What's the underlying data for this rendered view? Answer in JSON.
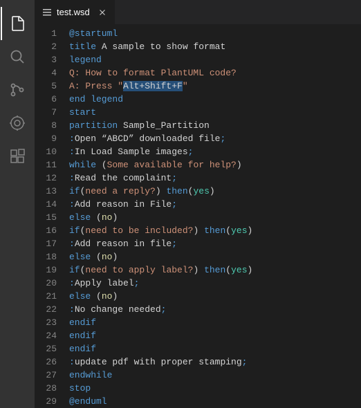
{
  "tab": {
    "filename": "test.wsd"
  },
  "lines": [
    {
      "n": 1,
      "tokens": [
        {
          "t": "@startuml",
          "c": "kw"
        }
      ]
    },
    {
      "n": 2,
      "tokens": [
        {
          "t": "title",
          "c": "kw"
        },
        {
          "t": " A sample to show format",
          "c": "txt"
        }
      ]
    },
    {
      "n": 3,
      "tokens": [
        {
          "t": "legend",
          "c": "kw"
        }
      ]
    },
    {
      "n": 4,
      "tokens": [
        {
          "t": "Q: How to format PlantUML code?",
          "c": "str"
        }
      ]
    },
    {
      "n": 5,
      "tokens": [
        {
          "t": "A: Press \"",
          "c": "str"
        },
        {
          "t": "Alt+Shift+F",
          "c": "sel"
        },
        {
          "t": "\"",
          "c": "str"
        }
      ]
    },
    {
      "n": 6,
      "tokens": [
        {
          "t": "end legend",
          "c": "kw"
        }
      ]
    },
    {
      "n": 7,
      "tokens": [
        {
          "t": "start",
          "c": "kw"
        }
      ]
    },
    {
      "n": 8,
      "tokens": [
        {
          "t": "partition",
          "c": "kw"
        },
        {
          "t": " Sample_Partition",
          "c": "txt"
        }
      ]
    },
    {
      "n": 9,
      "tokens": [
        {
          "t": ":",
          "c": "kw"
        },
        {
          "t": "Open “ABCD” downloaded file",
          "c": "txt"
        },
        {
          "t": ";",
          "c": "kw"
        }
      ]
    },
    {
      "n": 10,
      "tokens": [
        {
          "t": ":",
          "c": "kw"
        },
        {
          "t": "In Load Sample images",
          "c": "txt"
        },
        {
          "t": ";",
          "c": "kw"
        }
      ]
    },
    {
      "n": 11,
      "tokens": [
        {
          "t": "while",
          "c": "kw"
        },
        {
          "t": " (",
          "c": "par"
        },
        {
          "t": "Some available for help?",
          "c": "str"
        },
        {
          "t": ")",
          "c": "par"
        }
      ]
    },
    {
      "n": 12,
      "tokens": [
        {
          "t": ":",
          "c": "kw"
        },
        {
          "t": "Read the complaint",
          "c": "txt"
        },
        {
          "t": ";",
          "c": "kw"
        }
      ]
    },
    {
      "n": 13,
      "tokens": [
        {
          "t": "if",
          "c": "kw"
        },
        {
          "t": "(",
          "c": "par"
        },
        {
          "t": "need a reply?",
          "c": "str"
        },
        {
          "t": ") ",
          "c": "par"
        },
        {
          "t": "then",
          "c": "kw"
        },
        {
          "t": "(",
          "c": "par"
        },
        {
          "t": "yes",
          "c": "yes"
        },
        {
          "t": ")",
          "c": "par"
        }
      ]
    },
    {
      "n": 14,
      "tokens": [
        {
          "t": ":",
          "c": "kw"
        },
        {
          "t": "Add reason in File",
          "c": "txt"
        },
        {
          "t": ";",
          "c": "kw"
        }
      ]
    },
    {
      "n": 15,
      "tokens": [
        {
          "t": "else",
          "c": "kw"
        },
        {
          "t": " (",
          "c": "par"
        },
        {
          "t": "no",
          "c": "func"
        },
        {
          "t": ")",
          "c": "par"
        }
      ]
    },
    {
      "n": 16,
      "tokens": [
        {
          "t": "if",
          "c": "kw"
        },
        {
          "t": "(",
          "c": "par"
        },
        {
          "t": "need to be included?",
          "c": "str"
        },
        {
          "t": ") ",
          "c": "par"
        },
        {
          "t": "then",
          "c": "kw"
        },
        {
          "t": "(",
          "c": "par"
        },
        {
          "t": "yes",
          "c": "yes"
        },
        {
          "t": ")",
          "c": "par"
        }
      ]
    },
    {
      "n": 17,
      "tokens": [
        {
          "t": ":",
          "c": "kw"
        },
        {
          "t": "Add reason in file",
          "c": "txt"
        },
        {
          "t": ";",
          "c": "kw"
        }
      ]
    },
    {
      "n": 18,
      "tokens": [
        {
          "t": "else",
          "c": "kw"
        },
        {
          "t": " (",
          "c": "par"
        },
        {
          "t": "no",
          "c": "func"
        },
        {
          "t": ")",
          "c": "par"
        }
      ]
    },
    {
      "n": 19,
      "tokens": [
        {
          "t": "if",
          "c": "kw"
        },
        {
          "t": "(",
          "c": "par"
        },
        {
          "t": "need to apply label?",
          "c": "str"
        },
        {
          "t": ") ",
          "c": "par"
        },
        {
          "t": "then",
          "c": "kw"
        },
        {
          "t": "(",
          "c": "par"
        },
        {
          "t": "yes",
          "c": "yes"
        },
        {
          "t": ")",
          "c": "par"
        }
      ]
    },
    {
      "n": 20,
      "tokens": [
        {
          "t": ":",
          "c": "kw"
        },
        {
          "t": "Apply label",
          "c": "txt"
        },
        {
          "t": ";",
          "c": "kw"
        }
      ]
    },
    {
      "n": 21,
      "tokens": [
        {
          "t": "else",
          "c": "kw"
        },
        {
          "t": " (",
          "c": "par"
        },
        {
          "t": "no",
          "c": "func"
        },
        {
          "t": ")",
          "c": "par"
        }
      ]
    },
    {
      "n": 22,
      "tokens": [
        {
          "t": ":",
          "c": "kw"
        },
        {
          "t": "No change needed",
          "c": "txt"
        },
        {
          "t": ";",
          "c": "kw"
        }
      ]
    },
    {
      "n": 23,
      "tokens": [
        {
          "t": "endif",
          "c": "kw"
        }
      ]
    },
    {
      "n": 24,
      "tokens": [
        {
          "t": "endif",
          "c": "kw"
        }
      ]
    },
    {
      "n": 25,
      "tokens": [
        {
          "t": "endif",
          "c": "kw"
        }
      ]
    },
    {
      "n": 26,
      "tokens": [
        {
          "t": ":",
          "c": "kw"
        },
        {
          "t": "update pdf with proper stamping",
          "c": "txt"
        },
        {
          "t": ";",
          "c": "kw"
        }
      ]
    },
    {
      "n": 27,
      "tokens": [
        {
          "t": "endwhile",
          "c": "kw"
        }
      ]
    },
    {
      "n": 28,
      "tokens": [
        {
          "t": "stop",
          "c": "kw"
        }
      ]
    },
    {
      "n": 29,
      "tokens": [
        {
          "t": "@enduml",
          "c": "kw"
        }
      ]
    }
  ]
}
